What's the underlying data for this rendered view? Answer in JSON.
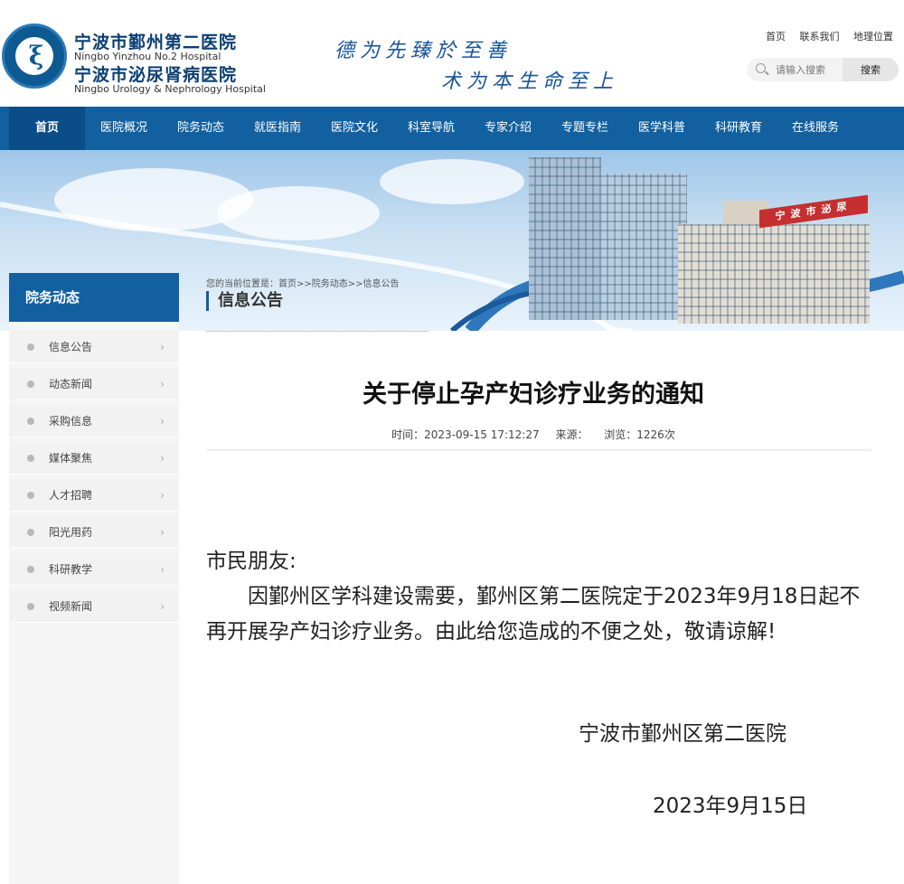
{
  "header": {
    "logo_name_cn_1": "宁波市鄞州第二医院",
    "logo_name_en_1": "Ningbo Yinzhou No.2 Hospital",
    "logo_name_cn_2": "宁波市泌尿肾病医院",
    "logo_name_en_2": "Ningbo Urology & Nephrology Hospital",
    "motto_1": "德为先臻於至善",
    "motto_2": "术为本生命至上",
    "top_links": [
      "首页",
      "联系我们",
      "地理位置"
    ],
    "search": {
      "placeholder": "请输入搜索",
      "button": "搜索"
    }
  },
  "nav": {
    "items": [
      "首页",
      "医院概况",
      "院务动态",
      "就医指南",
      "医院文化",
      "科室导航",
      "专家介绍",
      "专题专栏",
      "医学科普",
      "科研教育",
      "在线服务"
    ],
    "active": "首页"
  },
  "banner": {
    "sign_text": "宁波市泌尿"
  },
  "sidebar": {
    "title": "院务动态",
    "items": [
      "信息公告",
      "动态新闻",
      "采购信息",
      "媒体聚焦",
      "人才招聘",
      "阳光用药",
      "科研教学",
      "视频新闻"
    ]
  },
  "breadcrumb": "您的当前位置是：首页>>院务动态>>信息公告",
  "section_title": "信息公告",
  "article": {
    "title": "关于停止孕产妇诊疗业务的通知",
    "time": "时间：2023-09-15 17:12:27",
    "source": "来源：",
    "views": "浏览：1226次",
    "salutation": "市民朋友:",
    "paragraph": "因鄞州区学科建设需要，鄞州区第二医院定于2023年9月18日起不再开展孕产妇诊疗业务。由此给您造成的不便之处，敬请谅解!",
    "signature": "宁波市鄞州区第二医院",
    "date": "2023年9月15日"
  },
  "colors": {
    "brand_blue": "#12609f",
    "nav_active": "#0a4d88",
    "sign_red": "#c62f2f"
  }
}
